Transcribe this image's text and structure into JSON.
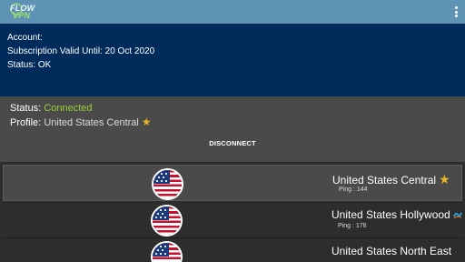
{
  "app": {
    "logo_text_top": "FLOW",
    "logo_text_bottom": "VPN",
    "menu_icon": "more-vert-icon"
  },
  "account": {
    "label": "Account:",
    "subscription": "Subscription Valid Until: 20 Oct 2020",
    "status": "Status: OK"
  },
  "connection": {
    "status_label": "Status:",
    "status_value": "Connected",
    "profile_label": "Profile:",
    "profile_value": "United States Central",
    "disconnect_label": "DISCONNECT"
  },
  "servers": [
    {
      "name": "United States Central",
      "ping": "Ping : 144",
      "badge": "star-icon",
      "selected": true
    },
    {
      "name": "United States Hollywood",
      "ping": "Ping : 176",
      "badge": "wave-icon",
      "selected": false
    },
    {
      "name": "United States North East",
      "ping": "",
      "badge": "",
      "selected": false
    }
  ],
  "colors": {
    "appbar": "#5f93b5",
    "account_bg": "#012b5a",
    "connected": "#9acd3a",
    "star": "#e5b428"
  }
}
